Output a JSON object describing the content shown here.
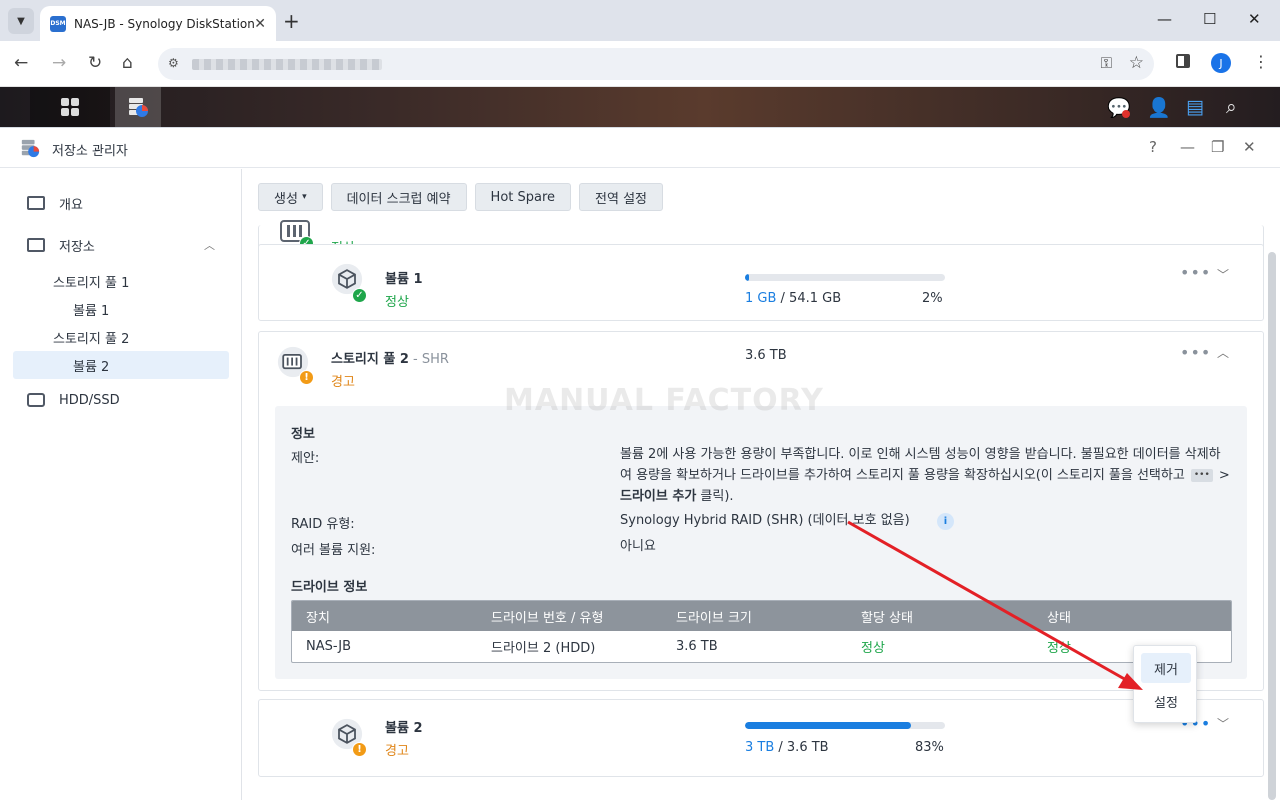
{
  "browser": {
    "tab_title": "NAS-JB - Synology DiskStation",
    "favicon_text": "DSM",
    "profile_initial": "J"
  },
  "app": {
    "title": "저장소 관리자"
  },
  "sidebar": {
    "items": [
      {
        "label": "개요"
      },
      {
        "label": "저장소"
      },
      {
        "label": "스토리지 풀 1"
      },
      {
        "label": "볼륨 1"
      },
      {
        "label": "스토리지 풀 2"
      },
      {
        "label": "볼륨 2"
      },
      {
        "label": "HDD/SSD"
      }
    ]
  },
  "actions": {
    "create": "생성",
    "scrub": "데이터 스크럽 예약",
    "hotspare": "Hot Spare",
    "global": "전역 설정"
  },
  "pool1": {
    "status": "정상"
  },
  "volume1": {
    "name": "볼륨 1",
    "status": "정상",
    "used": "1 GB",
    "total": " / 54.1 GB",
    "percent": "2%",
    "fill": 0.02
  },
  "pool2": {
    "name": "스토리지 풀 2",
    "raid_short": " - SHR",
    "status": "경고",
    "size": "3.6 TB",
    "info_heading": "정보",
    "suggestion_label": "제안:",
    "suggestion_text": "볼륨 2에 사용 가능한 용량이 부족합니다. 이로 인해 시스템 성능이 영향을 받습니다. 불필요한 데이터를 삭제하여 용량을 확보하거나 드라이브를 추가하여 스토리지 풀 용량을 확장하십시오(이 스토리지 풀을 선택하고",
    "suggestion_chip": "•••",
    "suggestion_gt": ">",
    "suggestion_bold": "드라이브 추가",
    "suggestion_tail": " 클릭).",
    "raid_label": "RAID 유형:",
    "raid_value": "Synology Hybrid RAID (SHR) (데이터 보호 없음)",
    "multi_label": "여러 볼륨 지원:",
    "multi_value": "아니요",
    "drive_heading": "드라이브 정보",
    "table_headers": [
      "장치",
      "드라이브 번호 / 유형",
      "드라이브 크기",
      "할당 상태",
      "상태"
    ],
    "table_rows": [
      [
        "NAS-JB",
        "드라이브 2 (HDD)",
        "3.6 TB",
        "정상",
        "정상"
      ]
    ]
  },
  "volume2": {
    "name": "볼륨 2",
    "status": "경고",
    "used": "3 TB",
    "total": " / 3.6 TB",
    "percent": "83%",
    "fill": 0.83
  },
  "context_menu": {
    "remove": "제거",
    "settings": "설정"
  },
  "watermark": "MANUAL FACTORY",
  "colors": {
    "accent": "#1a7ee0",
    "ok": "#1fa64b",
    "warn": "#e0871b",
    "annotation_arrow": "#e32026"
  }
}
